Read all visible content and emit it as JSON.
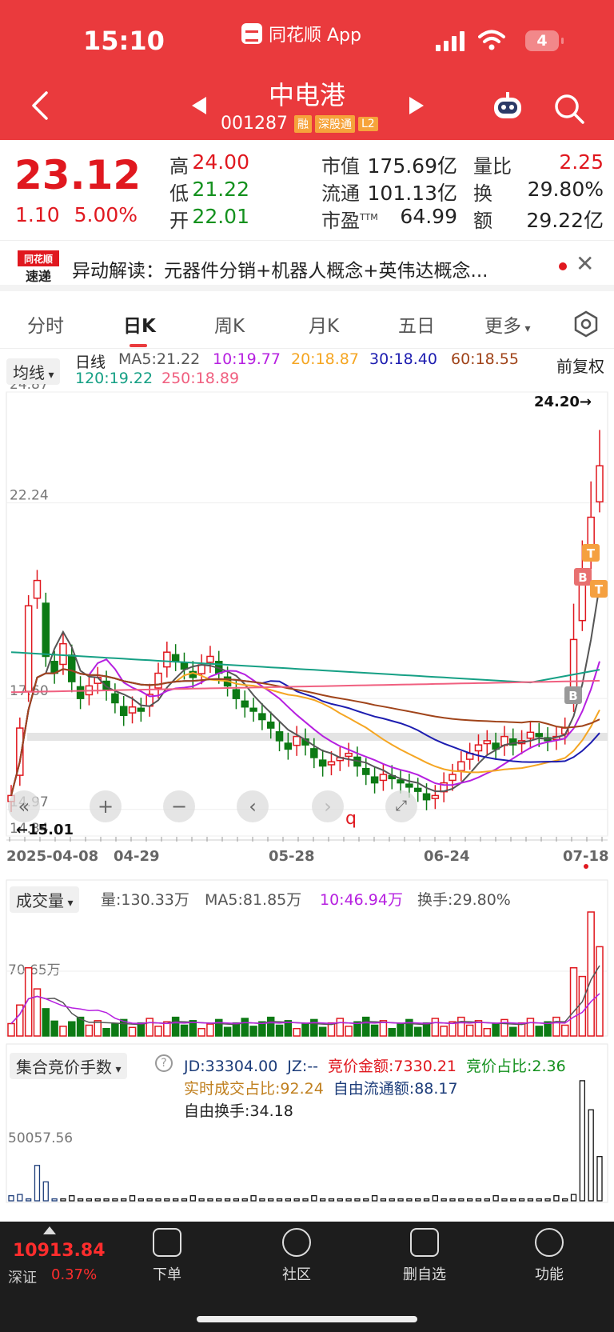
{
  "status": {
    "time": "15:10",
    "app_name": "同花顺 App",
    "battery": "4"
  },
  "header": {
    "name": "中电港",
    "code": "001287",
    "tags": [
      "融",
      "深股通",
      "L2"
    ]
  },
  "quote": {
    "price": "23.12",
    "change": "1.10",
    "change_pct": "5.00%",
    "fields": [
      {
        "label": "高",
        "value": "24.00",
        "color": "#e0181f"
      },
      {
        "label": "低",
        "value": "21.22",
        "color": "#14911e"
      },
      {
        "label": "开",
        "value": "22.01",
        "color": "#14911e"
      },
      {
        "label": "市值",
        "value": "175.69亿"
      },
      {
        "label": "流通",
        "value": "101.13亿"
      },
      {
        "label": "市盈",
        "label_sup": "TTM",
        "value": "64.99"
      },
      {
        "label": "量比",
        "value": "2.25",
        "color": "#e0181f"
      },
      {
        "label": "换",
        "value": "29.80%"
      },
      {
        "label": "额",
        "value": "29.22亿"
      }
    ]
  },
  "banner": {
    "logo_line1": "同花顺",
    "logo_line2": "速递",
    "text": "异动解读：元器件分销+机器人概念+英伟达概念..."
  },
  "tabs": [
    "分时",
    "日K",
    "周K",
    "月K",
    "五日",
    "更多"
  ],
  "active_tab": 1,
  "ma_legend": {
    "selector": "均线",
    "period": "日线",
    "adjust": "前复权",
    "items": [
      {
        "label": "MA5:21.22",
        "color": "#555555"
      },
      {
        "label": "10:19.77",
        "color": "#b620e0"
      },
      {
        "label": "20:18.87",
        "color": "#f5a623"
      },
      {
        "label": "30:18.40",
        "color": "#1d1db0"
      },
      {
        "label": "60:18.55",
        "color": "#a0441a"
      },
      {
        "label": "120:19.22",
        "color": "#16a085"
      },
      {
        "label": "250:18.89",
        "color": "#f06080"
      }
    ]
  },
  "chart_data": [
    {
      "type": "candlestick",
      "y_ticks": [
        "24.87",
        "22.24",
        "17.60",
        "14.97",
        "14.34"
      ],
      "ylim": [
        14.34,
        24.87
      ],
      "x_ticks": [
        "2025-04-08",
        "04-29",
        "05-28",
        "06-24",
        "07-18"
      ],
      "annotations": [
        "24.20→",
        "←15.01",
        "B",
        "T",
        "B",
        "T"
      ],
      "close": [
        15.3,
        16.9,
        19.8,
        20.4,
        18.6,
        18.2,
        18.9,
        18.0,
        17.6,
        17.9,
        18.1,
        17.8,
        17.5,
        17.2,
        17.4,
        17.3,
        17.7,
        18.2,
        18.7,
        18.5,
        18.3,
        18.1,
        18.4,
        18.6,
        18.2,
        17.9,
        17.6,
        17.4,
        17.3,
        17.1,
        16.9,
        16.6,
        16.4,
        16.7,
        16.5,
        16.2,
        16.0,
        16.1,
        16.2,
        16.3,
        16.0,
        15.8,
        15.6,
        15.8,
        15.7,
        15.6,
        15.5,
        15.4,
        15.2,
        15.3,
        15.6,
        15.8,
        16.1,
        16.3,
        16.5,
        16.6,
        16.4,
        16.7,
        16.5,
        16.6,
        16.8,
        16.7,
        16.6,
        16.7,
        16.9,
        19.0,
        20.5,
        21.9,
        23.12
      ],
      "volume_ticks": [
        "70.65万"
      ],
      "volume_legend": [
        "量:130.33万",
        "MA5:81.85万",
        "10:46.94万",
        "换手:29.80%"
      ],
      "auction_ticks": [
        "50057.56"
      ]
    }
  ],
  "volume": {
    "selector": "成交量"
  },
  "auction": {
    "selector": "集合竞价手数",
    "line1": [
      {
        "text": "JD:33304.00",
        "color": "#1d3d7a"
      },
      {
        "text": "JZ:--",
        "color": "#1d3d7a"
      },
      {
        "text": "竞价金额:7330.21",
        "color": "#e0181f"
      },
      {
        "text": "竞价占比:2.36",
        "color": "#14911e"
      }
    ],
    "line2": [
      {
        "text": "实时成交占比:92.24",
        "color": "#c08020"
      },
      {
        "text": "自由流通额:88.17",
        "color": "#1d3d7a"
      }
    ],
    "line3": [
      {
        "text": "自由换手:34.18",
        "color": "#222222"
      }
    ]
  },
  "footer": {
    "index_value": "10913.84",
    "index_name": "深证",
    "index_pct": "0.37%",
    "items": [
      "下单",
      "社区",
      "删自选",
      "功能"
    ]
  }
}
